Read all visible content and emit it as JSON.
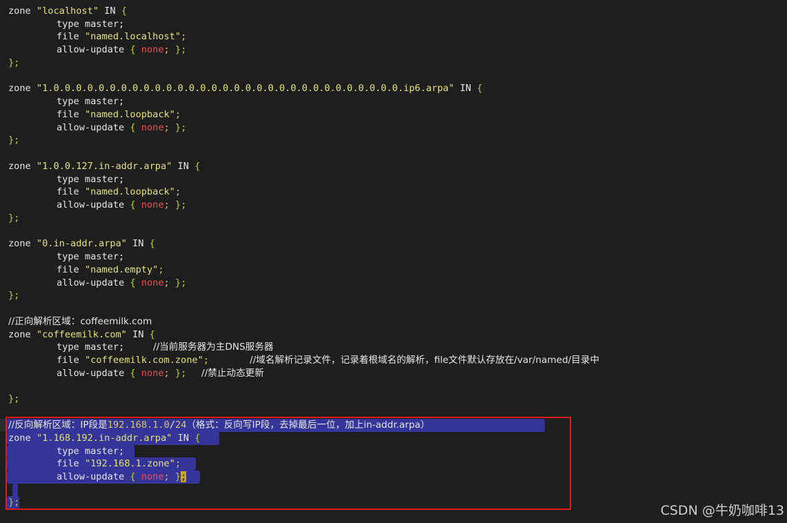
{
  "code": {
    "zone1": {
      "head": [
        "zone ",
        "\"localhost\"",
        " IN ",
        "{"
      ],
      "type": "type master;",
      "file": [
        "file ",
        "\"named.localhost\"",
        ";"
      ],
      "allow": [
        "allow-update ",
        "{ ",
        "none",
        "; ",
        "};"
      ],
      "close": "};"
    },
    "zone2": {
      "head": [
        "zone ",
        "\"1.0.0.0.0.0.0.0.0.0.0.0.0.0.0.0.0.0.0.0.0.0.0.0.0.0.0.0.0.0.0.0.ip6.arpa\"",
        " IN ",
        "{"
      ],
      "type": "type master;",
      "file": [
        "file ",
        "\"named.loopback\"",
        ";"
      ],
      "allow": [
        "allow-update ",
        "{ ",
        "none",
        "; ",
        "};"
      ],
      "close": "};"
    },
    "zone3": {
      "head": [
        "zone ",
        "\"1.0.0.127.in-addr.arpa\"",
        " IN ",
        "{"
      ],
      "type": "type master;",
      "file": [
        "file ",
        "\"named.loopback\"",
        ";"
      ],
      "allow": [
        "allow-update ",
        "{ ",
        "none",
        "; ",
        "};"
      ],
      "close": "};"
    },
    "zone4": {
      "head": [
        "zone ",
        "\"0.in-addr.arpa\"",
        " IN ",
        "{"
      ],
      "type": "type master;",
      "file": [
        "file ",
        "\"named.empty\"",
        ";"
      ],
      "allow": [
        "allow-update ",
        "{ ",
        "none",
        "; ",
        "};"
      ],
      "close": "};"
    },
    "zone5": {
      "comment": "//正向解析区域：coffeemilk.com",
      "head": [
        "zone ",
        "\"coffeemilk.com\"",
        " IN ",
        "{"
      ],
      "type": "type master;",
      "type_comment": "//当前服务器为主DNS服务器",
      "file": [
        "file ",
        "\"coffeemilk.com.zone\"",
        ";"
      ],
      "file_comment": "//域名解析记录文件，记录着根域名的解析，file文件默认存放在/var/named/目录中",
      "allow": [
        "allow-update ",
        "{ ",
        "none",
        "; ",
        "};"
      ],
      "allow_comment": "//禁止动态更新",
      "close": "};"
    },
    "zone6": {
      "comment": [
        "//反向解析区域：IP段是",
        "192.168.1.0",
        "/",
        "24",
        "（格式：反向写IP段，去掉最后一位，加上in-addr.arpa）"
      ],
      "head": [
        "zone ",
        "\"1.168.192.in-addr.arpa\"",
        " IN ",
        "{"
      ],
      "type": "type master;",
      "file": [
        "file ",
        "\"192.168.1.zone\"",
        ";"
      ],
      "allow": [
        "allow-update ",
        "{ ",
        "none",
        "; ",
        "}",
        ";"
      ],
      "close": "};"
    }
  },
  "watermark": "CSDN @牛奶咖啡13"
}
